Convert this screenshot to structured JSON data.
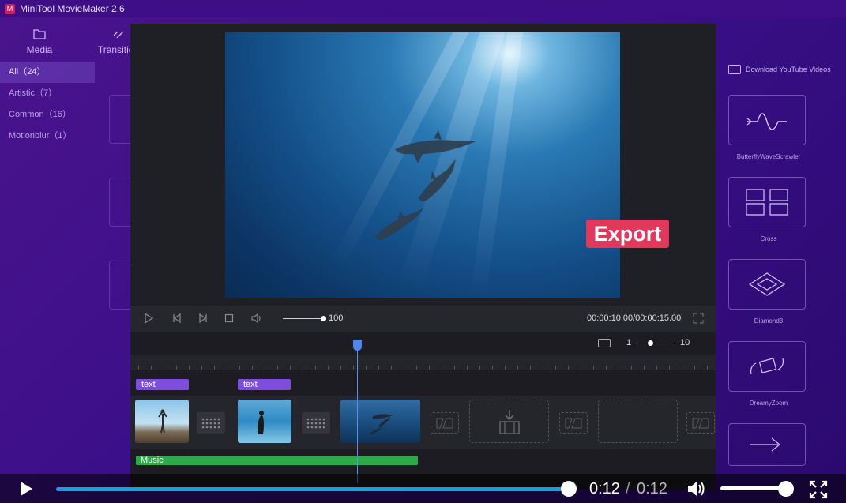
{
  "app": {
    "title": "MiniTool MovieMaker 2.6"
  },
  "topnav": [
    {
      "label": "Media",
      "icon": "folder-icon"
    },
    {
      "label": "Transition",
      "icon": "transition-icon"
    }
  ],
  "categories": [
    {
      "label": "All（24）",
      "active": true
    },
    {
      "label": "Artistic（7）",
      "active": false
    },
    {
      "label": "Common（16）",
      "active": false
    },
    {
      "label": "Motionblur（1）",
      "active": false
    }
  ],
  "right_panel": {
    "download_label": "Download YouTube Videos",
    "transitions": [
      "ButterflyWaveScrawler",
      "Cross",
      "Diamond3",
      "DreamyZoom"
    ]
  },
  "preview": {
    "overlay_text": "Export",
    "volume_value": "100",
    "timecode": "00:00:10.00/00:00:15.00"
  },
  "timeline": {
    "zoom_min": "1",
    "zoom_max": "10",
    "text_clips": [
      "text",
      "text"
    ],
    "music_clip": "Music"
  },
  "player": {
    "current_time": "0:12",
    "separator": "/",
    "total_time": "0:12",
    "progress": 1.0,
    "volume": 0.9
  },
  "colors": {
    "accent_purple": "#4a148c",
    "export_badge": "#e0395b",
    "seek_blue": "#12a0e0",
    "music_green": "#2ea84a",
    "text_clip": "#7c4ddf"
  }
}
